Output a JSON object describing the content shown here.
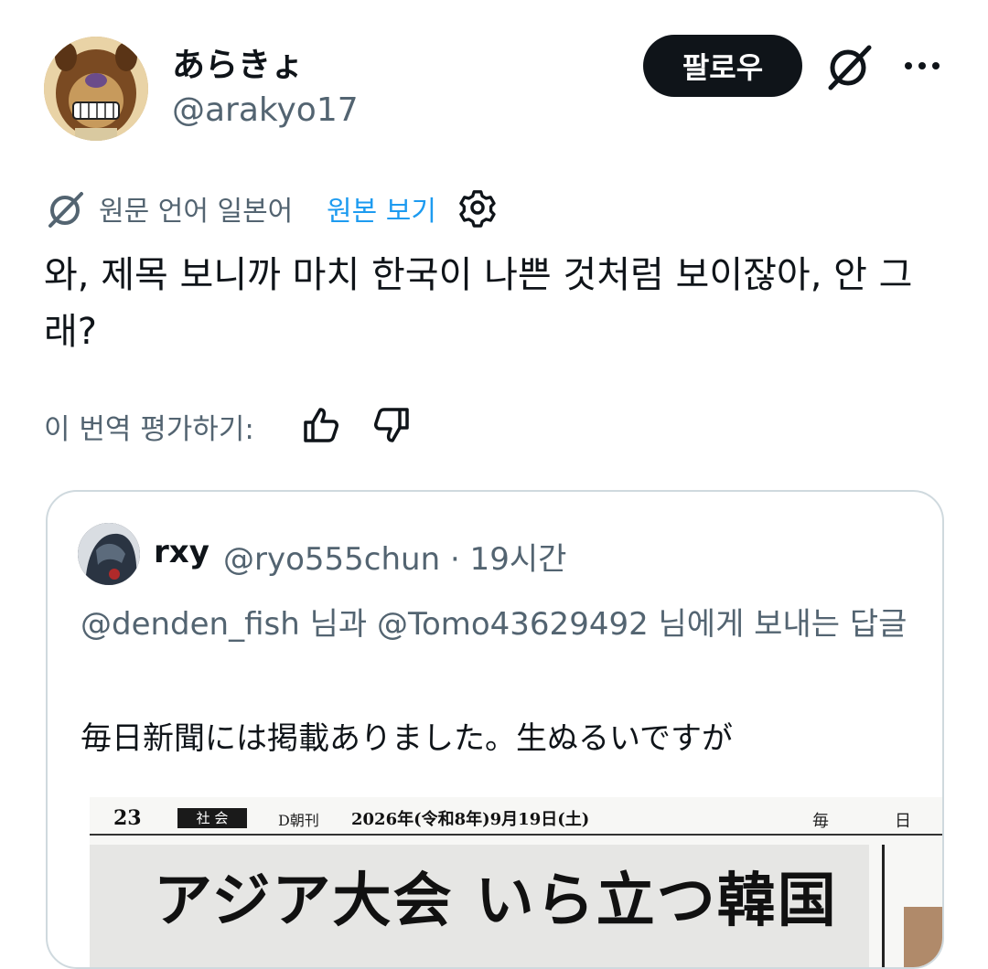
{
  "user": {
    "display_name": "あらきょ",
    "handle": "@arakyo17"
  },
  "header": {
    "follow_label": "팔로우",
    "grok_icon": "grok-icon",
    "more_icon": "more-icon"
  },
  "translation": {
    "note": "원문 언어 일본어",
    "view_original": "원본 보기",
    "icon": "translate-icon",
    "settings_icon": "gear-icon"
  },
  "tweet": {
    "text": "와, 제목 보니까 마치 한국이 나쁜 것처럼 보이잖아, 안 그래?"
  },
  "rating": {
    "label": "이 번역 평가하기:",
    "up_icon": "thumbs-up-icon",
    "down_icon": "thumbs-down-icon"
  },
  "quote": {
    "name": "rxy",
    "meta": "@ryo555chun · 19시간",
    "reply_to": "@denden_fish 님과 @Tomo43629492 님에게 보내는 답글",
    "text": "毎日新聞には掲載ありました。生ぬるいですが",
    "newspaper": {
      "page": "23",
      "section": "社 会",
      "edition": "D朝刊",
      "date": "2026年(令和8年)9月19日(土)",
      "mark1": "毎",
      "mark2": "日",
      "headline": "アジア大会 いら立つ韓国"
    }
  },
  "colors": {
    "text_primary": "#0f1419",
    "text_secondary": "#536471",
    "link": "#1d9bf0",
    "border": "#cfd9de",
    "button_bg": "#0f1419"
  }
}
